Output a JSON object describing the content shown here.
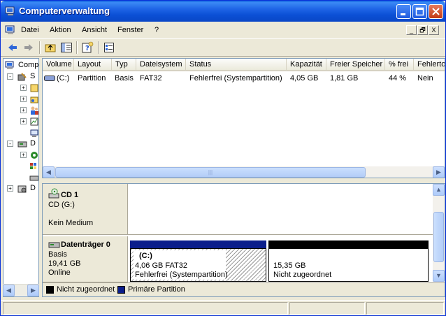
{
  "window": {
    "title": "Computerverwaltung",
    "colors": {
      "title_bar": "#0a5fdc",
      "selection": "#0b246a",
      "primary_partition": "#0b1e8b",
      "unallocated": "#000000"
    }
  },
  "menubar": {
    "items": [
      "Datei",
      "Aktion",
      "Ansicht",
      "Fenster",
      "?"
    ],
    "mdi_buttons": [
      "_",
      "🗗",
      "X"
    ]
  },
  "toolbar": {
    "icons": [
      "back-arrow-icon",
      "forward-arrow-icon",
      "up-folder-icon",
      "show-hide-tree-icon",
      "help-icon",
      "properties-icon"
    ]
  },
  "tree": {
    "items": [
      {
        "label": "Comp",
        "expander": "-"
      },
      {
        "label": "S",
        "expander": "-"
      },
      {
        "label": "",
        "expander": "+"
      },
      {
        "label": "",
        "expander": "+"
      },
      {
        "label": "",
        "expander": "+"
      },
      {
        "label": "",
        "expander": "+"
      },
      {
        "label": "",
        "expander": ""
      },
      {
        "label": "D",
        "expander": "-"
      },
      {
        "label": "",
        "expander": "+"
      },
      {
        "label": "",
        "expander": ""
      },
      {
        "label": "",
        "expander": ""
      },
      {
        "label": "D",
        "expander": "+"
      }
    ]
  },
  "volume_list": {
    "columns": [
      "Volume",
      "Layout",
      "Typ",
      "Dateisystem",
      "Status",
      "Kapazität",
      "Freier Speicher",
      "% frei",
      "Fehlerto"
    ],
    "rows": [
      [
        "(C:)",
        "Partition",
        "Basis",
        "FAT32",
        "Fehlerfrei (Systempartition)",
        "4,05 GB",
        "1,81 GB",
        "44 %",
        "Nein"
      ]
    ]
  },
  "disks": [
    {
      "name": "CD 1",
      "lines": [
        "CD (G:)",
        "",
        "Kein Medium"
      ]
    },
    {
      "name": "Datenträger 0",
      "lines": [
        "Basis",
        "19,41 GB",
        "Online"
      ],
      "partitions": [
        {
          "title": "(C:)",
          "size": "4,06 GB FAT32",
          "status": "Fehlerfrei (Systempartition)"
        },
        {
          "title": "",
          "size": "15,35 GB",
          "status": "Nicht zugeordnet"
        }
      ]
    }
  ],
  "legend": {
    "items": [
      "Nicht zugeordnet",
      "Primäre Partition"
    ]
  }
}
